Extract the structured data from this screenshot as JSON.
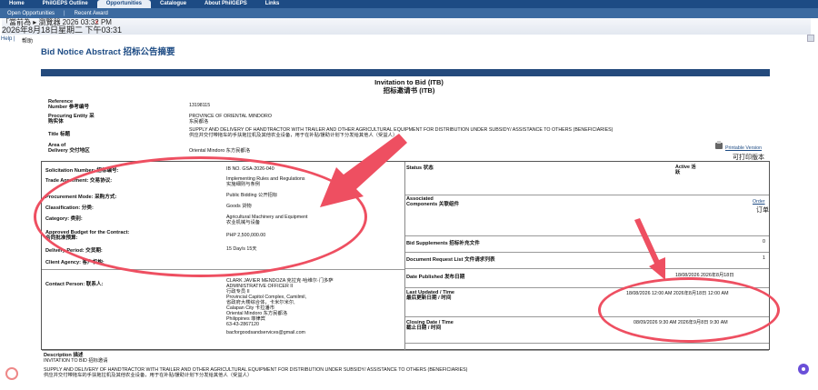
{
  "topnav": [
    "Home",
    "PhilGEPS Outline",
    "Opportunities",
    "Catalogue",
    "About PhilGEPS",
    "Links"
  ],
  "subnav": {
    "item1": "Open Opportunities",
    "sep": "|",
    "item2": "Recent Award"
  },
  "clock": {
    "line1": "「當前為 ▸ 瀏覽器 2026 03:32 PM",
    "line2": "2026年8月18日星期二 下午03:31",
    "close": "x"
  },
  "help": {
    "label": "Help",
    "sep": "|",
    "cn": "帮助"
  },
  "page_title": "Bid Notice Abstract 招标公告摘要",
  "itb": {
    "title": "Invitation to Bid (ITB)",
    "title_cn": "招标邀请书 (ITB)"
  },
  "header_fields": {
    "reference_label1": "Reference",
    "reference_label2": "Number 参考编号",
    "reference_value": "13198115",
    "procuring_label1": "Procuring Entity 采",
    "procuring_label2": "购实体",
    "procuring_value1": "PROVINCE OF ORIENTAL MINDORO",
    "procuring_value2": "东民都洛",
    "title_label": "Title 标题",
    "title_value1": "SUPPLY AND DELIVERY OF HANDTRACTOR WITH TRAILER AND OTHER AGRICULTURAL EQUIPMENT FOR DISTRIBUTION UNDER SUBSIDY/ ASSISTANCE TO OTHERS (BENEFICIARIES)",
    "title_value2": "供应并交付带拖车的手扶拖拉机及其他农业设备，用于在补贴/援助计划下分发给其他人（受益人）",
    "area_label1": "Area of",
    "area_label2": "Delivery 交付地区",
    "area_value": "Oriental Mindoro 东方民都洛",
    "print_link": "Printable Version",
    "print_cn": "可打印版本"
  },
  "left_fields": [
    {
      "label": "Solicitation Number: 招标编号:",
      "value": "IB NO. GSA-2026-040"
    },
    {
      "label": "Trade Agreement: 交易协议:",
      "value": "Implementing Rules and Regulations",
      "value2": "实施细则与条例"
    },
    {
      "label": "Procurement Mode: 采购方式:",
      "value": "Public Bidding 公开招标"
    },
    {
      "label": "Classification: 分类:",
      "value": "Goods 货物"
    },
    {
      "label": "Category: 类别:",
      "value": "Agricultural Machinery and Equipment",
      "value2": "农业机械与设备"
    },
    {
      "label": "Approved Budget for the Contract:",
      "label2": "合同批准预算:",
      "value": "PHP 2,500,000.00"
    },
    {
      "label": "Delivery Period: 交货期:",
      "value": "15 Day/s 15天"
    },
    {
      "label": "Client Agency: 客户机构:",
      "value": ""
    }
  ],
  "contact": {
    "label": "Contact Person: 联系人:",
    "lines": [
      "CLARK JAVIER MENDOZA 克拉克·哈维尔·门多萨",
      "ADMINISTRATIVE OFFICER II",
      "行政专员 II",
      "Provincial Capitol Complex, Camilmil,",
      "省政府大楼综合体，卡米尔米尔,",
      "Calapan City 卡拉潘市",
      "Oriental Mindoro 东方民都洛",
      "Philippines 菲律宾",
      "63-43-2867120",
      "",
      "bacforgoodsandservices@gmail.com"
    ]
  },
  "right_fields": {
    "status_label": "Status 状态",
    "status_value": "Active 活",
    "status_value2": "跃",
    "assoc_label1": "Associated",
    "assoc_label2": "Components 关联组件",
    "order_link": "Order",
    "order_cn": "订单",
    "bid_supp_label": "Bid Supplements 招标补充文件",
    "bid_supp_value": "0",
    "doc_req_label": "Document Request List 文件请求列表",
    "doc_req_value": "1",
    "date_pub_label": "Date Published 发布日期",
    "date_pub_value": "18/08/2026 2026年8月18日",
    "last_upd_label1": "Last Updated / Time",
    "last_upd_label2": "最后更新日期 / 时间",
    "last_upd_value": "18/08/2026 12:00 AM 2026年8月18日 12:00 AM",
    "closing_label1": "Closing Date / Time",
    "closing_label2": "截止日期 / 时间",
    "closing_value": "08/09/2026 9:30 AM 2026年9月8日 9:30 AM"
  },
  "description": {
    "label": "Description 描述",
    "line1": "INVITATION TO BID 招标邀请",
    "line2": "SUPPLY AND DELIVERY OF HANDTRACTOR WITH TRAILER AND OTHER AGRICULTURAL EQUIPMENT FOR DISTRIBUTION UNDER SUBSIDY/ ASSISTANCE TO OTHERS (BENEFICIARIES)",
    "line3": "供应并交付带拖车的手扶拖拉机及其他农业设备，用于在补贴/援助计划下分发给其他人（受益人）"
  },
  "colors": {
    "nav": "#1d4b84",
    "subnav": "#3b6aa0",
    "annotation": "#ee4f61",
    "bar": "#244a7c"
  }
}
